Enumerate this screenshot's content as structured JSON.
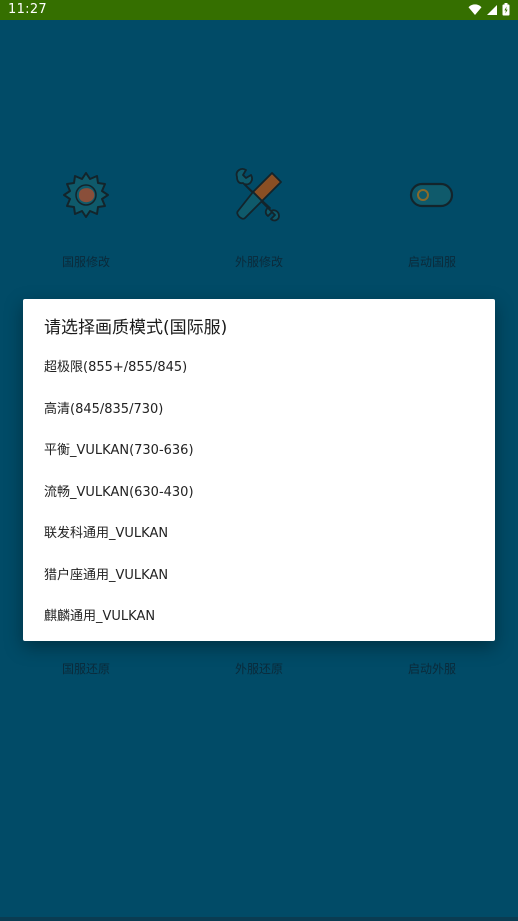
{
  "status_bar": {
    "time": "11:27"
  },
  "tiles_top": [
    {
      "label": "国服修改",
      "icon": "gear-icon"
    },
    {
      "label": "外服修改",
      "icon": "tools-icon"
    },
    {
      "label": "启动国服",
      "icon": "toggle-icon"
    }
  ],
  "tiles_bottom": [
    {
      "label": "国服还原"
    },
    {
      "label": "外服还原"
    },
    {
      "label": "启动外服"
    }
  ],
  "dialog": {
    "title": "请选择画质模式(国际服)",
    "options": [
      "超极限(855+/855/845)",
      "高清(845/835/730)",
      "平衡_VULKAN(730-636)",
      "流畅_VULKAN(630-430)",
      "联发科通用_VULKAN",
      "猎户座通用_VULKAN",
      "麒麟通用_VULKAN"
    ]
  },
  "colors": {
    "status_bar": "#356f00",
    "background": "#014b67",
    "dialog_bg": "#ffffff",
    "gear_fill": "#0f5a6b",
    "tool_brown": "#8a4f24"
  }
}
